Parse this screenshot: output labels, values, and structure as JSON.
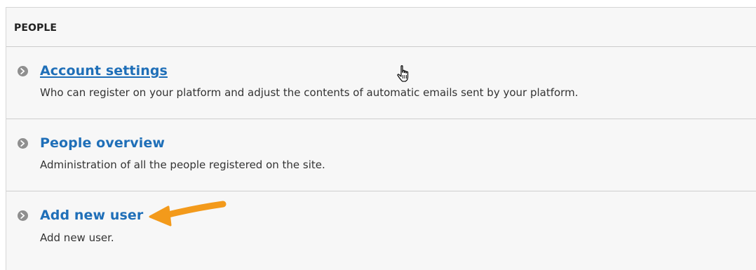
{
  "section": {
    "title": "PEOPLE"
  },
  "items": [
    {
      "label": "Account settings",
      "description": "Who can register on your platform and adjust the contents of automatic emails sent by your platform."
    },
    {
      "label": "People overview",
      "description": "Administration of all the people registered on the site."
    },
    {
      "label": "Add new user",
      "description": "Add new user."
    }
  ],
  "icons": {
    "bullet": "chevron-right-circle-icon",
    "cursor": "hand-pointer-icon",
    "annotation": "orange-arrow-icon"
  },
  "colors": {
    "link": "#1f6fb8",
    "annotation_arrow": "#f39a1b",
    "bullet": "#8f8f8f"
  }
}
